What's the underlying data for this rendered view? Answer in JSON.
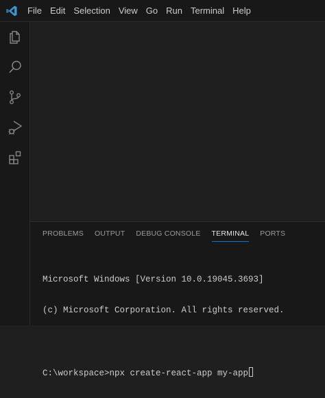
{
  "menu": {
    "items": [
      "File",
      "Edit",
      "Selection",
      "View",
      "Go",
      "Run",
      "Terminal",
      "Help"
    ]
  },
  "activity_bar": {
    "icons": [
      "explorer-icon",
      "search-icon",
      "source-control-icon",
      "run-debug-icon",
      "extensions-icon"
    ]
  },
  "panel": {
    "tabs": [
      "PROBLEMS",
      "OUTPUT",
      "DEBUG CONSOLE",
      "TERMINAL",
      "PORTS"
    ],
    "active_tab": "TERMINAL"
  },
  "terminal": {
    "lines": [
      "Microsoft Windows [Version 10.0.19045.3693]",
      "(c) Microsoft Corporation. All rights reserved.",
      "",
      "C:\\workspace>npx create-react-app my-app"
    ]
  },
  "colors": {
    "accent": "#0078d4",
    "vscode_logo": "#3c99d4",
    "background": "#1f1f1f",
    "bar": "#181818"
  }
}
